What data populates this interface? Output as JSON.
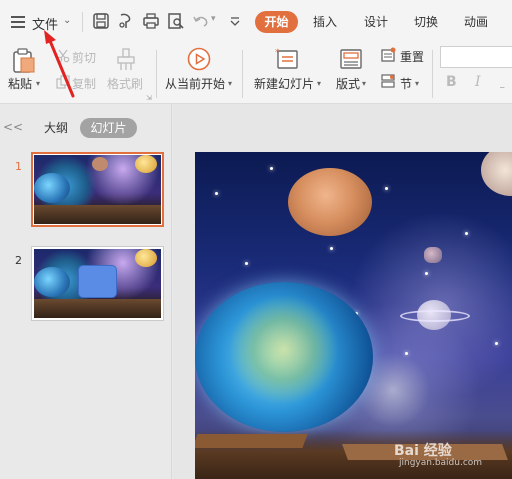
{
  "file_menu": {
    "label": "文件"
  },
  "tabs": [
    {
      "label": "开始",
      "active": true
    },
    {
      "label": "插入",
      "active": false
    },
    {
      "label": "设计",
      "active": false
    },
    {
      "label": "切换",
      "active": false
    },
    {
      "label": "动画",
      "active": false
    }
  ],
  "ribbon": {
    "paste": "粘贴",
    "cut": "剪切",
    "copy": "复制",
    "format_painter": "格式刷",
    "from_current": "从当前开始",
    "new_slide": "新建幻灯片",
    "layout": "版式",
    "reset": "重置",
    "section": "节",
    "bold": "B",
    "italic": "I"
  },
  "panel": {
    "collapse": "<<",
    "outline_tab": "大纲",
    "slides_tab": "幻灯片",
    "thumbnails": [
      {
        "number": "1",
        "selected": true
      },
      {
        "number": "2",
        "selected": false
      }
    ]
  },
  "watermark": {
    "text": "Bai 经验",
    "sub": "jingyan.baidu.com"
  },
  "colors": {
    "accent": "#e2703f",
    "annotation_arrow": "#e32222"
  }
}
